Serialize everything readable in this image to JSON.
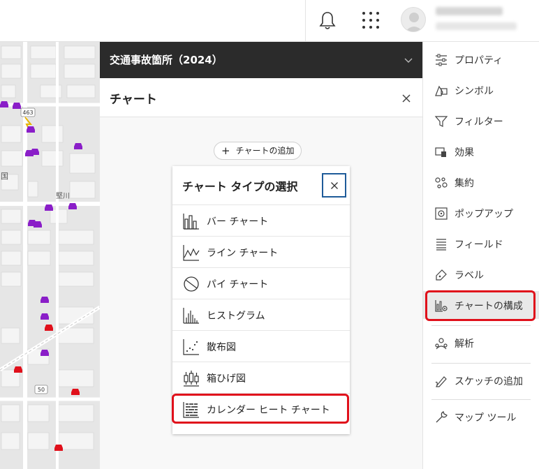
{
  "header": {
    "notifications_icon": "bell-icon",
    "apps_icon": "grid-icon"
  },
  "map": {
    "labels": [
      "463",
      "国",
      "堅川",
      "50"
    ]
  },
  "layer": {
    "title": "交通事故箇所（2024）"
  },
  "panel": {
    "title": "チャート",
    "add_chart_label": "チャートの追加"
  },
  "chooser": {
    "title": "チャート タイプの選択",
    "items": [
      {
        "label": "バー チャート",
        "icon": "bar-chart-icon"
      },
      {
        "label": "ライン チャート",
        "icon": "line-chart-icon"
      },
      {
        "label": "パイ チャート",
        "icon": "pie-chart-icon"
      },
      {
        "label": "ヒストグラム",
        "icon": "histogram-icon"
      },
      {
        "label": "散布図",
        "icon": "scatter-plot-icon"
      },
      {
        "label": "箱ひげ図",
        "icon": "box-plot-icon"
      },
      {
        "label": "カレンダー ヒート チャート",
        "icon": "calendar-heat-chart-icon"
      }
    ]
  },
  "toolbar": {
    "items": [
      {
        "label": "プロパティ",
        "icon": "properties-icon"
      },
      {
        "label": "シンボル",
        "icon": "symbol-icon"
      },
      {
        "label": "フィルター",
        "icon": "filter-icon"
      },
      {
        "label": "効果",
        "icon": "effects-icon"
      },
      {
        "label": "集約",
        "icon": "aggregation-icon"
      },
      {
        "label": "ポップアップ",
        "icon": "popup-icon"
      },
      {
        "label": "フィールド",
        "icon": "fields-icon"
      },
      {
        "label": "ラベル",
        "icon": "labels-icon"
      },
      {
        "label": "チャートの構成",
        "icon": "configure-charts-icon"
      },
      {
        "label": "解析",
        "icon": "analysis-icon"
      },
      {
        "label": "スケッチの追加",
        "icon": "sketch-icon"
      },
      {
        "label": "マップ ツール",
        "icon": "map-tools-icon"
      }
    ]
  },
  "colors": {
    "highlight": "#e0101b",
    "header_bg": "#2b2b2b",
    "accent": "#1e5b99",
    "marker_purple": "#8a1ec8",
    "marker_red": "#e0101b"
  }
}
